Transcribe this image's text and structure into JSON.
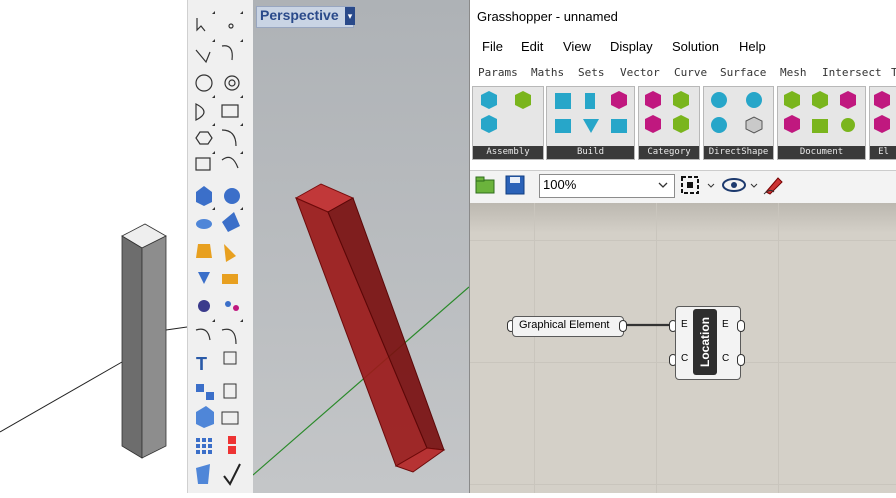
{
  "rhino": {
    "viewport_name": "Perspective"
  },
  "grasshopper": {
    "title": "Grasshopper - unnamed",
    "menu": [
      "File",
      "Edit",
      "View",
      "Display",
      "Solution",
      "Help"
    ],
    "tabs": [
      "Params",
      "Maths",
      "Sets",
      "Vector",
      "Curve",
      "Surface",
      "Mesh",
      "Intersect",
      "T"
    ],
    "panels": [
      "Assembly",
      "Build",
      "Category",
      "DirectShape",
      "Document",
      "El"
    ],
    "zoom": "100%",
    "components": {
      "graphical_element": {
        "label": "Graphical Element"
      },
      "location": {
        "label": "Location",
        "inputs": [
          "E",
          "C"
        ],
        "outputs": [
          "E",
          "C"
        ]
      }
    }
  },
  "colors": {
    "rhino_box": "#9b1a1a",
    "gh_canvas": "#d4d0c8",
    "panel_footer": "#3a3a3a",
    "icon_green": "#7ab51d",
    "icon_cyan": "#27a6c9",
    "icon_magenta": "#c0187f"
  }
}
